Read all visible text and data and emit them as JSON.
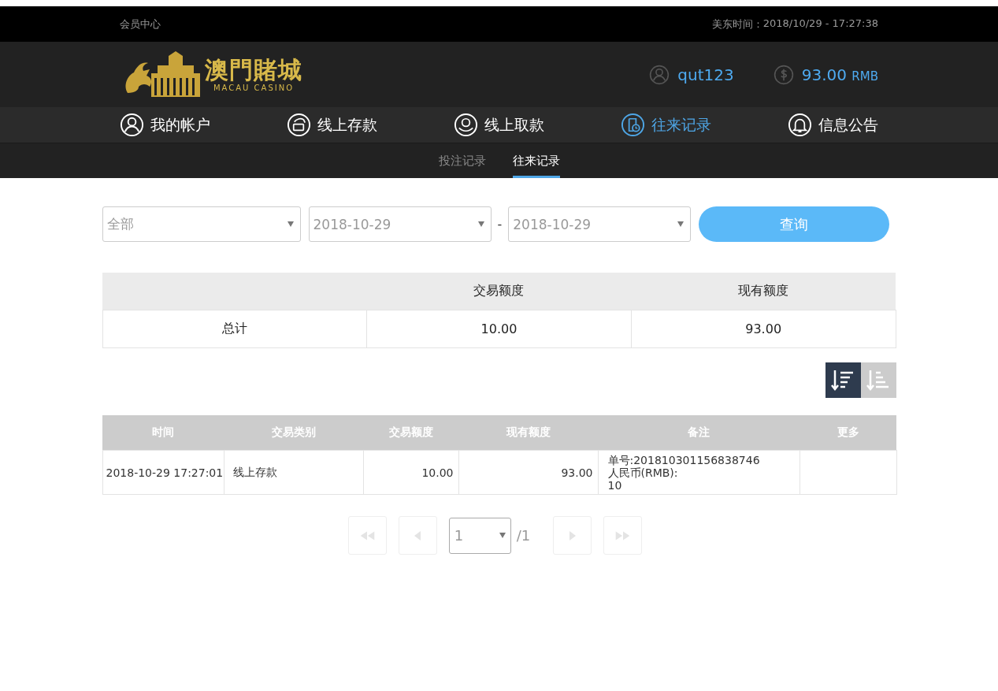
{
  "top_bar": {
    "title": "会员中心",
    "time_label": "美东时间：",
    "time": "2018/10/29 - 17:27:38"
  },
  "header": {
    "logo": {
      "name": "澳門賭城",
      "subtitle": "MACAU CASINO"
    },
    "username": "qut123",
    "balance": "93.00",
    "currency": "RMB"
  },
  "nav": [
    {
      "label": "我的帐户",
      "kind": "user",
      "selected": false
    },
    {
      "label": "线上存款",
      "kind": "deposit",
      "selected": false
    },
    {
      "label": "线上取款",
      "kind": "withdraw",
      "selected": false
    },
    {
      "label": "往来记录",
      "kind": "record",
      "selected": true
    },
    {
      "label": "信息公告",
      "kind": "bell",
      "selected": false
    }
  ],
  "subnav": [
    {
      "label": "投注记录",
      "selected": false
    },
    {
      "label": "往来记录",
      "selected": true
    }
  ],
  "filters": {
    "type": "全部",
    "date_from": "2018-10-29",
    "separator": "-",
    "date_to": "2018-10-29",
    "button": "查询"
  },
  "summary": {
    "columns": [
      "交易额度",
      "现有额度"
    ],
    "rows": [
      {
        "label": "总计",
        "amount": "10.00",
        "balance": "93.00"
      }
    ]
  },
  "sort_buttons": [
    {
      "kind": "desc",
      "selected": true
    },
    {
      "kind": "asc",
      "selected": false
    }
  ],
  "table": {
    "columns": [
      "时间",
      "交易类别",
      "交易额度",
      "现有额度",
      "备注",
      "更多"
    ],
    "rows": [
      {
        "time": "2018-10-29 17:27:01",
        "type": "线上存款",
        "amount": "10.00",
        "balance": "93.00",
        "note": [
          "单号:201810301156838746",
          "人民币(RMB):",
          "10"
        ]
      }
    ]
  },
  "pagination": {
    "page": "1",
    "total": "/1",
    "buttons": [
      {
        "kind": "first",
        "disabled": true
      },
      {
        "kind": "prev",
        "disabled": true
      },
      {
        "kind": "next",
        "disabled": true
      },
      {
        "kind": "last",
        "disabled": true
      }
    ]
  }
}
